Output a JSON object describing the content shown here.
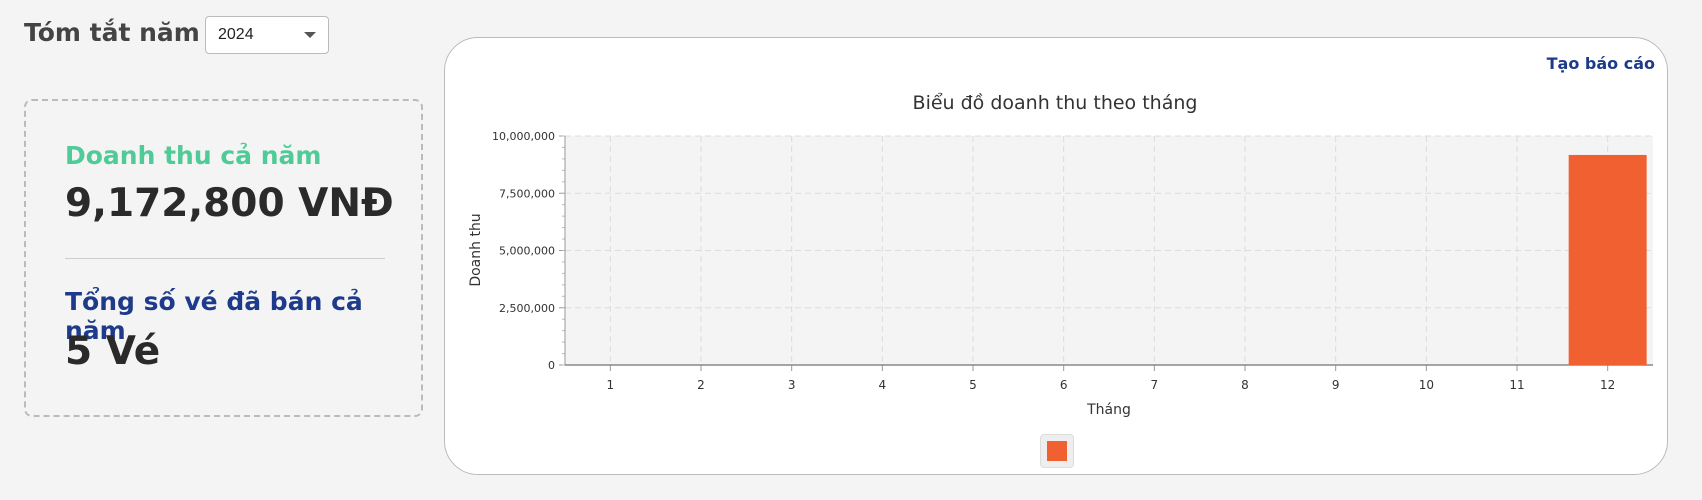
{
  "header": {
    "title": "Tóm tắt năm",
    "year_selected": "2024"
  },
  "summary": {
    "revenue_label": "Doanh thu cả năm",
    "revenue_value": "9,172,800 VNĐ",
    "tickets_label": "Tổng số vé đã bán cả năm",
    "tickets_value": "5 Vé"
  },
  "report_link": "Tạo báo cáo",
  "colors": {
    "bar": "#f06030",
    "revenue_label": "#4ecb96",
    "tickets_label": "#1e3a8a"
  },
  "chart_data": {
    "type": "bar",
    "title": "Biểu đồ doanh thu theo tháng",
    "xlabel": "Tháng",
    "ylabel": "Doanh thu",
    "categories": [
      "1",
      "2",
      "3",
      "4",
      "5",
      "6",
      "7",
      "8",
      "9",
      "10",
      "11",
      "12"
    ],
    "values": [
      0,
      0,
      0,
      0,
      0,
      0,
      0,
      0,
      0,
      0,
      0,
      9172800
    ],
    "ylim": [
      0,
      10000000
    ],
    "yticks": [
      0,
      2500000,
      5000000,
      7500000,
      10000000
    ],
    "ytick_labels": [
      "0",
      "2,500,000",
      "5,000,000",
      "7,500,000",
      "10,000,000"
    ],
    "grid": true,
    "legend": "bottom"
  }
}
